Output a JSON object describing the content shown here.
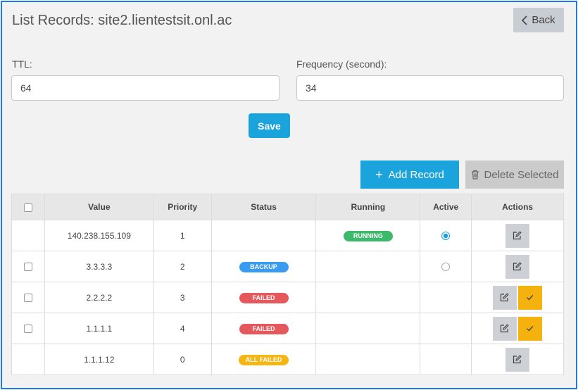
{
  "header": {
    "title": "List Records: site2.lientestsit.onl.ac",
    "back_label": "Back"
  },
  "form": {
    "ttl_label": "TTL:",
    "ttl_value": "64",
    "freq_label": "Frequency (second):",
    "freq_value": "34",
    "save_label": "Save"
  },
  "toolbar": {
    "add_label": "Add Record",
    "delete_label": "Delete Selected"
  },
  "table": {
    "headers": [
      "Value",
      "Priority",
      "Status",
      "Running",
      "Active",
      "Actions"
    ],
    "rows": [
      {
        "value": "140.238.155.109",
        "priority": "1",
        "status": "",
        "running": "RUNNING",
        "active": true,
        "has_checkbox": false,
        "confirm": false
      },
      {
        "value": "3.3.3.3",
        "priority": "2",
        "status": "BACKUP",
        "running": "",
        "active": false,
        "has_checkbox": true,
        "confirm": false
      },
      {
        "value": "2.2.2.2",
        "priority": "3",
        "status": "FAILED",
        "running": "",
        "active": null,
        "has_checkbox": true,
        "confirm": true
      },
      {
        "value": "1.1.1.1",
        "priority": "4",
        "status": "FAILED",
        "running": "",
        "active": null,
        "has_checkbox": true,
        "confirm": true
      },
      {
        "value": "1.1.1.12",
        "priority": "0",
        "status": "ALL FAILED",
        "running": "",
        "active": null,
        "has_checkbox": false,
        "confirm": false
      }
    ]
  },
  "colors": {
    "accent": "#1ba3dc",
    "running": "#3cb96a",
    "backup": "#3a9cf0",
    "failed": "#e5585b",
    "all_failed": "#f5b512",
    "confirm": "#f5b20e"
  },
  "icons": [
    "chevron-left-icon",
    "plus-icon",
    "trash-icon",
    "edit-icon",
    "check-icon"
  ]
}
